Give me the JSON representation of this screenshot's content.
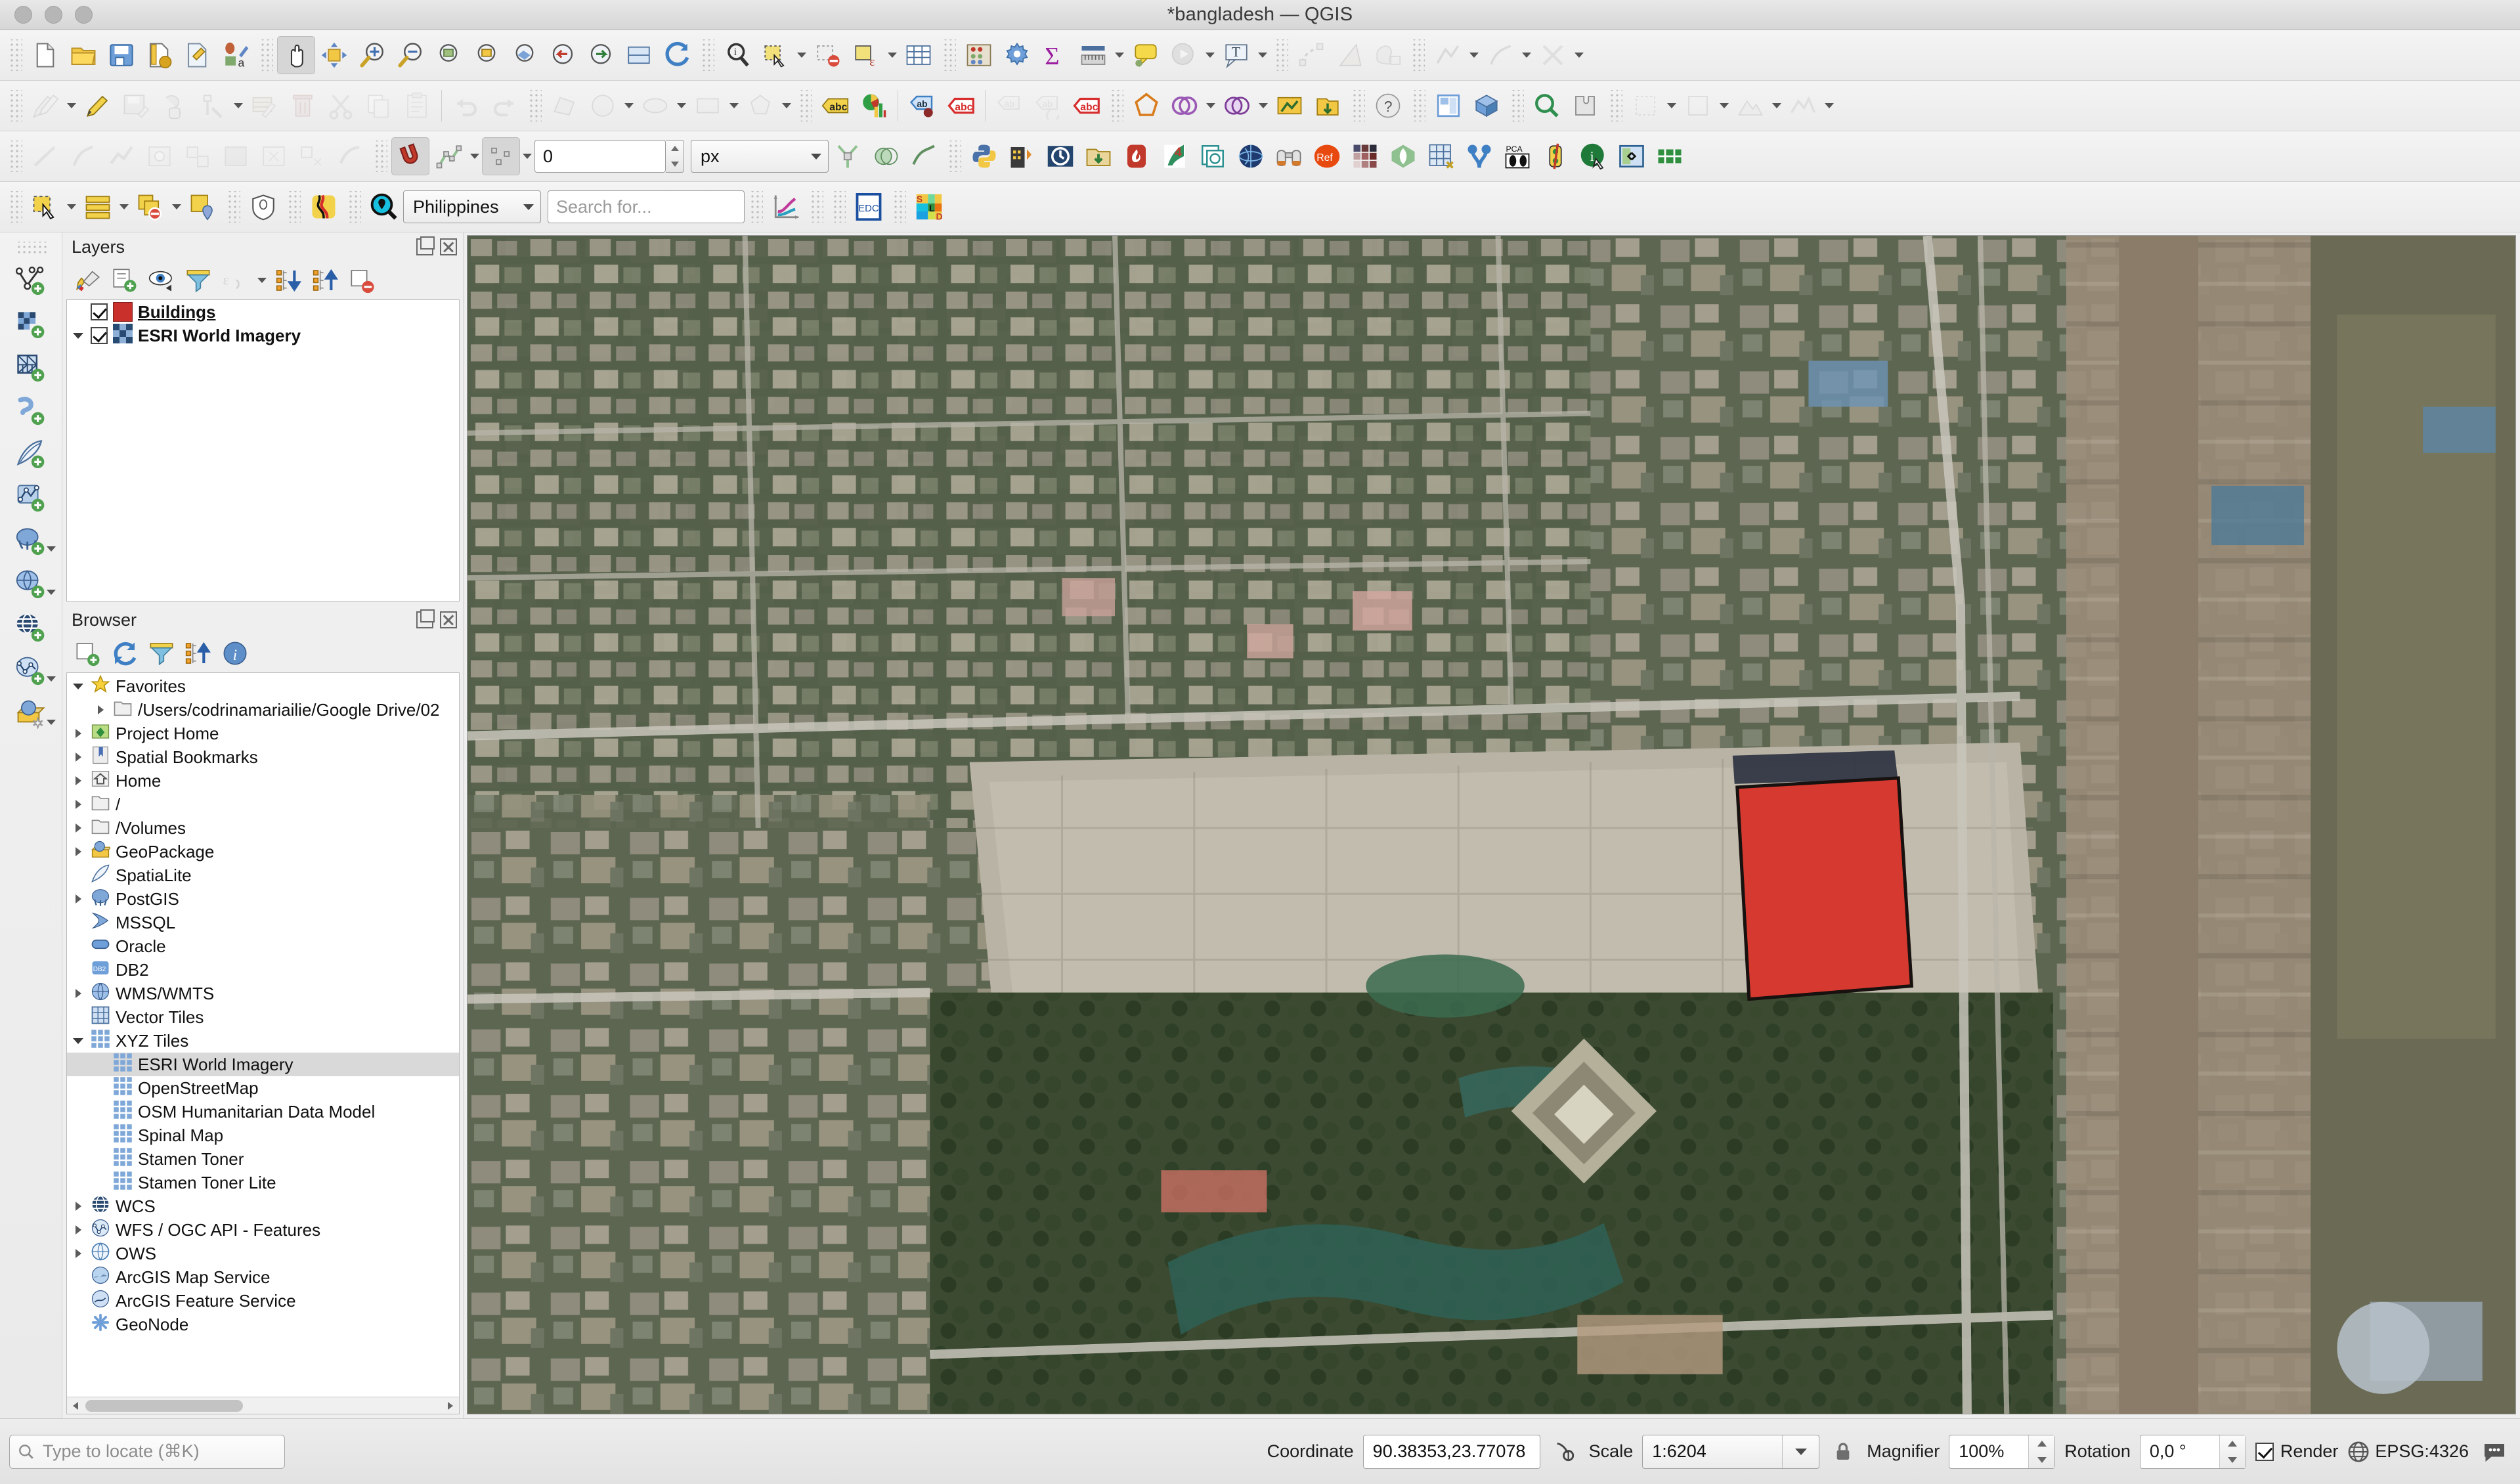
{
  "window": {
    "title": "*bangladesh — QGIS"
  },
  "panels": {
    "layers": {
      "title": "Layers",
      "items": [
        {
          "label": "Buildings",
          "checked": true,
          "style": "bold-underline",
          "swatch": "#c9302c",
          "expandable": false
        },
        {
          "label": "ESRI World Imagery",
          "checked": true,
          "style": "bold",
          "swatch": "checker",
          "expandable": true
        }
      ],
      "tools": [
        "open-layer-styling-icon",
        "add-group-icon",
        "manage-map-themes-icon",
        "filter-legend-icon",
        "expression-filter-icon",
        "expand-all-icon",
        "collapse-all-icon",
        "remove-layer-icon"
      ]
    },
    "browser": {
      "title": "Browser",
      "tools": [
        "add-layer-icon",
        "refresh-icon",
        "filter-browser-icon",
        "collapse-all-icon",
        "properties-icon"
      ],
      "items": [
        {
          "label": "Favorites",
          "icon": "star-icon",
          "indent": 0,
          "arrow": "down"
        },
        {
          "label": "/Users/codrinamariailie/Google Drive/02",
          "icon": "folder-icon",
          "indent": 1,
          "arrow": "right"
        },
        {
          "label": "Project Home",
          "icon": "project-home-icon",
          "indent": 0,
          "arrow": "right"
        },
        {
          "label": "Spatial Bookmarks",
          "icon": "bookmark-icon",
          "indent": 0,
          "arrow": "right"
        },
        {
          "label": "Home",
          "icon": "home-icon",
          "indent": 0,
          "arrow": "right"
        },
        {
          "label": "/",
          "icon": "folder-icon",
          "indent": 0,
          "arrow": "right"
        },
        {
          "label": "/Volumes",
          "icon": "folder-icon",
          "indent": 0,
          "arrow": "right"
        },
        {
          "label": "GeoPackage",
          "icon": "geopackage-icon",
          "indent": 0,
          "arrow": "right"
        },
        {
          "label": "SpatiaLite",
          "icon": "spatialite-icon",
          "indent": 0,
          "arrow": "none"
        },
        {
          "label": "PostGIS",
          "icon": "postgis-icon",
          "indent": 0,
          "arrow": "right"
        },
        {
          "label": "MSSQL",
          "icon": "mssql-icon",
          "indent": 0,
          "arrow": "none"
        },
        {
          "label": "Oracle",
          "icon": "oracle-icon",
          "indent": 0,
          "arrow": "none"
        },
        {
          "label": "DB2",
          "icon": "db2-icon",
          "indent": 0,
          "arrow": "none"
        },
        {
          "label": "WMS/WMTS",
          "icon": "wms-icon",
          "indent": 0,
          "arrow": "right"
        },
        {
          "label": "Vector Tiles",
          "icon": "vector-tiles-icon",
          "indent": 0,
          "arrow": "none"
        },
        {
          "label": "XYZ Tiles",
          "icon": "xyz-tiles-icon",
          "indent": 0,
          "arrow": "down"
        },
        {
          "label": "ESRI World Imagery",
          "icon": "xyz-tiles-icon",
          "indent": 1,
          "arrow": "none",
          "selected": true
        },
        {
          "label": "OpenStreetMap",
          "icon": "xyz-tiles-icon",
          "indent": 1,
          "arrow": "none"
        },
        {
          "label": "OSM Humanitarian Data Model",
          "icon": "xyz-tiles-icon",
          "indent": 1,
          "arrow": "none"
        },
        {
          "label": "Spinal Map",
          "icon": "xyz-tiles-icon",
          "indent": 1,
          "arrow": "none"
        },
        {
          "label": "Stamen Toner",
          "icon": "xyz-tiles-icon",
          "indent": 1,
          "arrow": "none"
        },
        {
          "label": "Stamen Toner Lite",
          "icon": "xyz-tiles-icon",
          "indent": 1,
          "arrow": "none"
        },
        {
          "label": "WCS",
          "icon": "wcs-icon",
          "indent": 0,
          "arrow": "right"
        },
        {
          "label": "WFS / OGC API - Features",
          "icon": "wfs-icon",
          "indent": 0,
          "arrow": "right"
        },
        {
          "label": "OWS",
          "icon": "ows-icon",
          "indent": 0,
          "arrow": "right"
        },
        {
          "label": "ArcGIS Map Service",
          "icon": "arcgis-map-icon",
          "indent": 0,
          "arrow": "none"
        },
        {
          "label": "ArcGIS Feature Service",
          "icon": "arcgis-feature-icon",
          "indent": 0,
          "arrow": "none"
        },
        {
          "label": "GeoNode",
          "icon": "geonode-icon",
          "indent": 0,
          "arrow": "none"
        }
      ]
    }
  },
  "toolbars": {
    "snapping": {
      "tolerance_value": "0",
      "unit_value": "px"
    },
    "plugin_bar": {
      "country_value": "Philippines",
      "search_placeholder": "Search for...",
      "edc_label": "EDC"
    }
  },
  "statusbar": {
    "locate_placeholder": "Type to locate (⌘K)",
    "coordinate_label": "Coordinate",
    "coordinate_value": "90.38353,23.77078",
    "scale_label": "Scale",
    "scale_value": "1:6204",
    "magnifier_label": "Magnifier",
    "magnifier_value": "100%",
    "rotation_label": "Rotation",
    "rotation_value": "0,0 °",
    "render_label": "Render",
    "crs_value": "EPSG:4326"
  },
  "map": {
    "feature_fill": "#d6392f",
    "feature_stroke": "#17110f"
  }
}
